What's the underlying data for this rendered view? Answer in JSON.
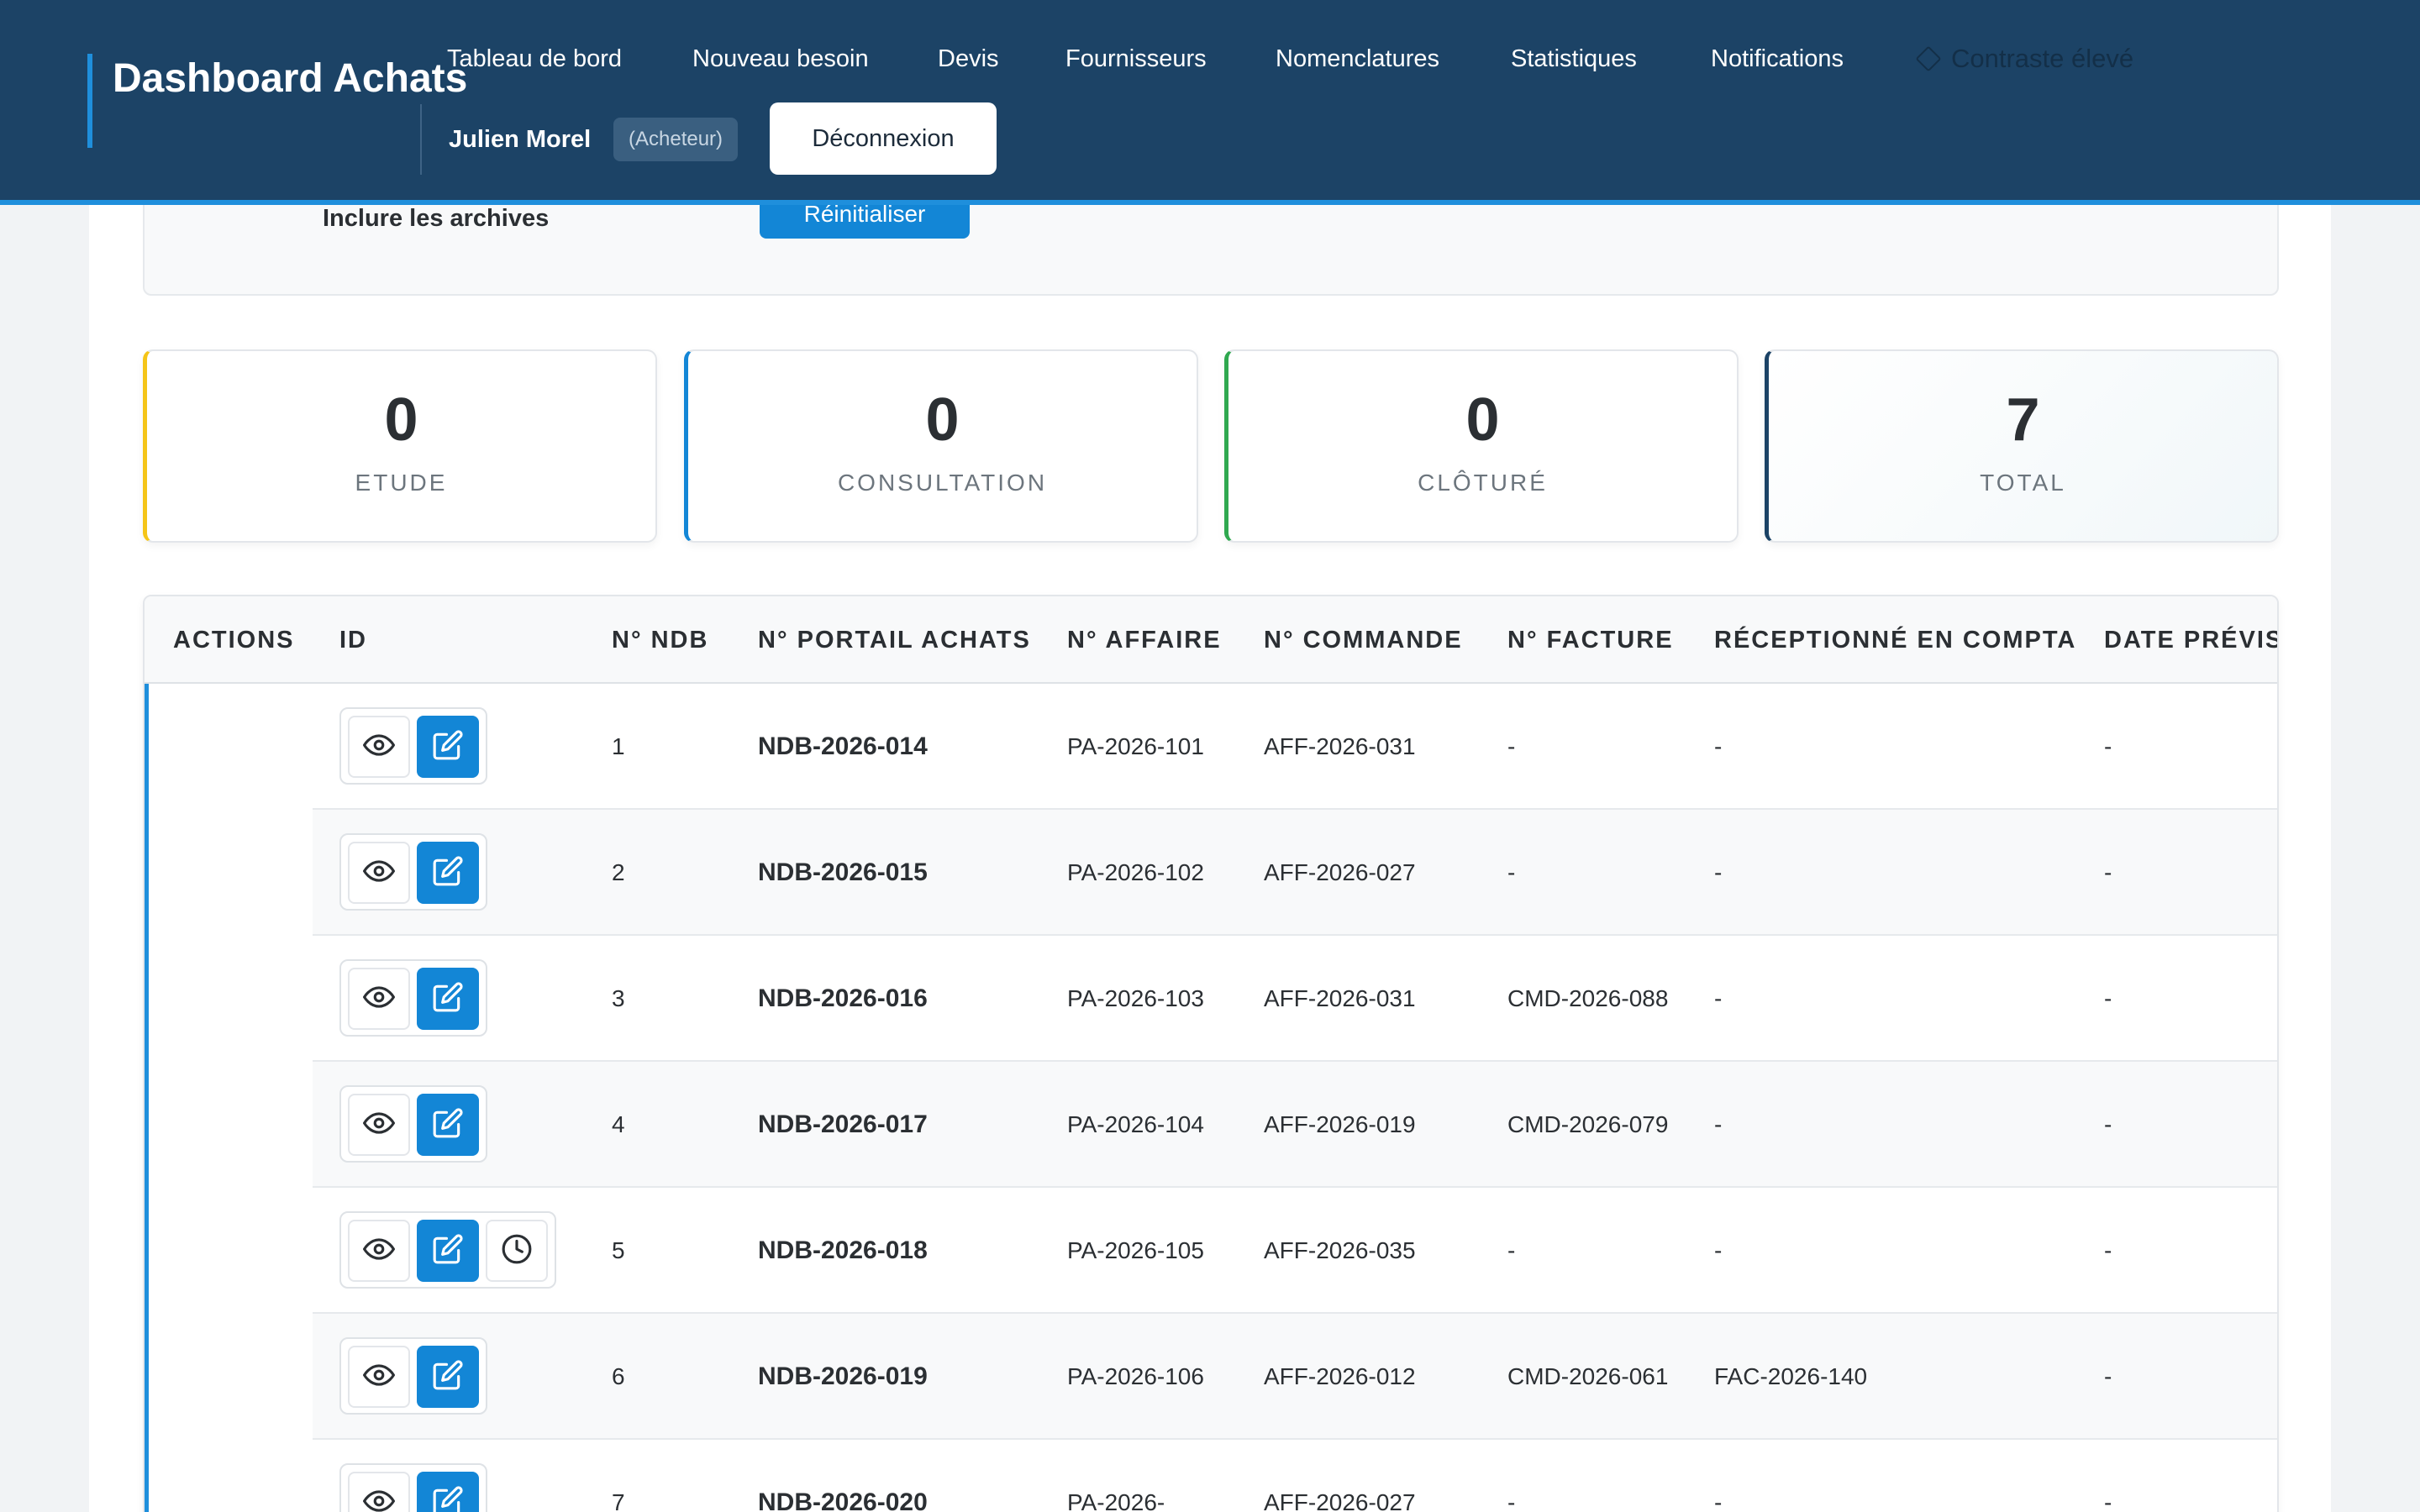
{
  "header": {
    "brand": "Dashboard Achats",
    "nav": [
      {
        "label": "Tableau de bord"
      },
      {
        "label": "Nouveau besoin"
      },
      {
        "label": "Devis"
      },
      {
        "label": "Fournisseurs"
      },
      {
        "label": "Nomenclatures"
      },
      {
        "label": "Statistiques"
      },
      {
        "label": "Notifications"
      }
    ],
    "contrast_label": "Contraste élevé",
    "user_name": "Julien Morel",
    "user_role": "(Acheteur)",
    "logout_label": "Déconnexion",
    "colors": {
      "background": "#1c4366",
      "accent": "#1f8fdc"
    }
  },
  "filters": {
    "archives_label": "Inclure les archives",
    "reset_label": "Réinitialiser"
  },
  "stats": [
    {
      "value": "0",
      "label": "ETUDE",
      "color": "#f5c518"
    },
    {
      "value": "0",
      "label": "CONSULTATION",
      "color": "#1386d6"
    },
    {
      "value": "0",
      "label": "CLÔTURÉ",
      "color": "#2fa84f"
    },
    {
      "value": "7",
      "label": "TOTAL",
      "color": "#1c4366"
    }
  ],
  "table": {
    "columns": [
      {
        "label": "ACTIONS"
      },
      {
        "label": "ID"
      },
      {
        "label": "N° NDB"
      },
      {
        "label": "N° PORTAIL ACHATS"
      },
      {
        "label": "N° AFFAIRE"
      },
      {
        "label": "N° COMMANDE"
      },
      {
        "label": "N° FACTURE"
      },
      {
        "label": "RÉCEPTIONNÉ EN COMPTA"
      },
      {
        "label": "DATE PRÉVISI"
      }
    ],
    "rows": [
      {
        "id": "1",
        "ndb": "NDB-2026-014",
        "portail": "PA-2026-101",
        "affaire": "AFF-2026-031",
        "commande": "-",
        "facture": "-",
        "date": "-",
        "history": false
      },
      {
        "id": "2",
        "ndb": "NDB-2026-015",
        "portail": "PA-2026-102",
        "affaire": "AFF-2026-027",
        "commande": "-",
        "facture": "-",
        "date": "-",
        "history": false
      },
      {
        "id": "3",
        "ndb": "NDB-2026-016",
        "portail": "PA-2026-103",
        "affaire": "AFF-2026-031",
        "commande": "CMD-2026-088",
        "facture": "-",
        "date": "-",
        "history": false
      },
      {
        "id": "4",
        "ndb": "NDB-2026-017",
        "portail": "PA-2026-104",
        "affaire": "AFF-2026-019",
        "commande": "CMD-2026-079",
        "facture": "-",
        "date": "-",
        "history": false
      },
      {
        "id": "5",
        "ndb": "NDB-2026-018",
        "portail": "PA-2026-105",
        "affaire": "AFF-2026-035",
        "commande": "-",
        "facture": "-",
        "date": "-",
        "history": true
      },
      {
        "id": "6",
        "ndb": "NDB-2026-019",
        "portail": "PA-2026-106",
        "affaire": "AFF-2026-012",
        "commande": "CMD-2026-061",
        "facture": "FAC-2026-140",
        "date": "-",
        "history": false
      },
      {
        "id": "7",
        "ndb": "NDB-2026-020",
        "portail": "PA-2026-",
        "affaire": "AFF-2026-027",
        "commande": "-",
        "facture": "-",
        "date": "-",
        "history": false
      }
    ],
    "icons": {
      "view": "eye-icon",
      "edit": "edit-icon",
      "history": "clock-icon"
    }
  }
}
